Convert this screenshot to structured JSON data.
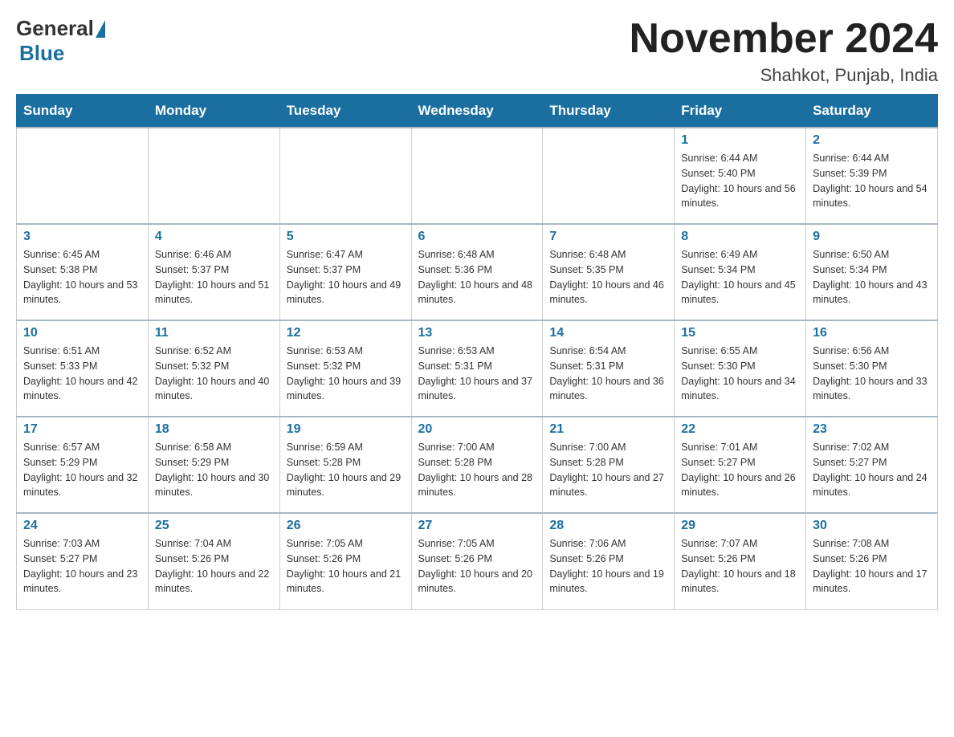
{
  "header": {
    "logo_general": "General",
    "logo_blue": "Blue",
    "month_title": "November 2024",
    "location": "Shahkot, Punjab, India"
  },
  "days_of_week": [
    "Sunday",
    "Monday",
    "Tuesday",
    "Wednesday",
    "Thursday",
    "Friday",
    "Saturday"
  ],
  "weeks": [
    [
      {
        "day": "",
        "sunrise": "",
        "sunset": "",
        "daylight": ""
      },
      {
        "day": "",
        "sunrise": "",
        "sunset": "",
        "daylight": ""
      },
      {
        "day": "",
        "sunrise": "",
        "sunset": "",
        "daylight": ""
      },
      {
        "day": "",
        "sunrise": "",
        "sunset": "",
        "daylight": ""
      },
      {
        "day": "",
        "sunrise": "",
        "sunset": "",
        "daylight": ""
      },
      {
        "day": "1",
        "sunrise": "Sunrise: 6:44 AM",
        "sunset": "Sunset: 5:40 PM",
        "daylight": "Daylight: 10 hours and 56 minutes."
      },
      {
        "day": "2",
        "sunrise": "Sunrise: 6:44 AM",
        "sunset": "Sunset: 5:39 PM",
        "daylight": "Daylight: 10 hours and 54 minutes."
      }
    ],
    [
      {
        "day": "3",
        "sunrise": "Sunrise: 6:45 AM",
        "sunset": "Sunset: 5:38 PM",
        "daylight": "Daylight: 10 hours and 53 minutes."
      },
      {
        "day": "4",
        "sunrise": "Sunrise: 6:46 AM",
        "sunset": "Sunset: 5:37 PM",
        "daylight": "Daylight: 10 hours and 51 minutes."
      },
      {
        "day": "5",
        "sunrise": "Sunrise: 6:47 AM",
        "sunset": "Sunset: 5:37 PM",
        "daylight": "Daylight: 10 hours and 49 minutes."
      },
      {
        "day": "6",
        "sunrise": "Sunrise: 6:48 AM",
        "sunset": "Sunset: 5:36 PM",
        "daylight": "Daylight: 10 hours and 48 minutes."
      },
      {
        "day": "7",
        "sunrise": "Sunrise: 6:48 AM",
        "sunset": "Sunset: 5:35 PM",
        "daylight": "Daylight: 10 hours and 46 minutes."
      },
      {
        "day": "8",
        "sunrise": "Sunrise: 6:49 AM",
        "sunset": "Sunset: 5:34 PM",
        "daylight": "Daylight: 10 hours and 45 minutes."
      },
      {
        "day": "9",
        "sunrise": "Sunrise: 6:50 AM",
        "sunset": "Sunset: 5:34 PM",
        "daylight": "Daylight: 10 hours and 43 minutes."
      }
    ],
    [
      {
        "day": "10",
        "sunrise": "Sunrise: 6:51 AM",
        "sunset": "Sunset: 5:33 PM",
        "daylight": "Daylight: 10 hours and 42 minutes."
      },
      {
        "day": "11",
        "sunrise": "Sunrise: 6:52 AM",
        "sunset": "Sunset: 5:32 PM",
        "daylight": "Daylight: 10 hours and 40 minutes."
      },
      {
        "day": "12",
        "sunrise": "Sunrise: 6:53 AM",
        "sunset": "Sunset: 5:32 PM",
        "daylight": "Daylight: 10 hours and 39 minutes."
      },
      {
        "day": "13",
        "sunrise": "Sunrise: 6:53 AM",
        "sunset": "Sunset: 5:31 PM",
        "daylight": "Daylight: 10 hours and 37 minutes."
      },
      {
        "day": "14",
        "sunrise": "Sunrise: 6:54 AM",
        "sunset": "Sunset: 5:31 PM",
        "daylight": "Daylight: 10 hours and 36 minutes."
      },
      {
        "day": "15",
        "sunrise": "Sunrise: 6:55 AM",
        "sunset": "Sunset: 5:30 PM",
        "daylight": "Daylight: 10 hours and 34 minutes."
      },
      {
        "day": "16",
        "sunrise": "Sunrise: 6:56 AM",
        "sunset": "Sunset: 5:30 PM",
        "daylight": "Daylight: 10 hours and 33 minutes."
      }
    ],
    [
      {
        "day": "17",
        "sunrise": "Sunrise: 6:57 AM",
        "sunset": "Sunset: 5:29 PM",
        "daylight": "Daylight: 10 hours and 32 minutes."
      },
      {
        "day": "18",
        "sunrise": "Sunrise: 6:58 AM",
        "sunset": "Sunset: 5:29 PM",
        "daylight": "Daylight: 10 hours and 30 minutes."
      },
      {
        "day": "19",
        "sunrise": "Sunrise: 6:59 AM",
        "sunset": "Sunset: 5:28 PM",
        "daylight": "Daylight: 10 hours and 29 minutes."
      },
      {
        "day": "20",
        "sunrise": "Sunrise: 7:00 AM",
        "sunset": "Sunset: 5:28 PM",
        "daylight": "Daylight: 10 hours and 28 minutes."
      },
      {
        "day": "21",
        "sunrise": "Sunrise: 7:00 AM",
        "sunset": "Sunset: 5:28 PM",
        "daylight": "Daylight: 10 hours and 27 minutes."
      },
      {
        "day": "22",
        "sunrise": "Sunrise: 7:01 AM",
        "sunset": "Sunset: 5:27 PM",
        "daylight": "Daylight: 10 hours and 26 minutes."
      },
      {
        "day": "23",
        "sunrise": "Sunrise: 7:02 AM",
        "sunset": "Sunset: 5:27 PM",
        "daylight": "Daylight: 10 hours and 24 minutes."
      }
    ],
    [
      {
        "day": "24",
        "sunrise": "Sunrise: 7:03 AM",
        "sunset": "Sunset: 5:27 PM",
        "daylight": "Daylight: 10 hours and 23 minutes."
      },
      {
        "day": "25",
        "sunrise": "Sunrise: 7:04 AM",
        "sunset": "Sunset: 5:26 PM",
        "daylight": "Daylight: 10 hours and 22 minutes."
      },
      {
        "day": "26",
        "sunrise": "Sunrise: 7:05 AM",
        "sunset": "Sunset: 5:26 PM",
        "daylight": "Daylight: 10 hours and 21 minutes."
      },
      {
        "day": "27",
        "sunrise": "Sunrise: 7:05 AM",
        "sunset": "Sunset: 5:26 PM",
        "daylight": "Daylight: 10 hours and 20 minutes."
      },
      {
        "day": "28",
        "sunrise": "Sunrise: 7:06 AM",
        "sunset": "Sunset: 5:26 PM",
        "daylight": "Daylight: 10 hours and 19 minutes."
      },
      {
        "day": "29",
        "sunrise": "Sunrise: 7:07 AM",
        "sunset": "Sunset: 5:26 PM",
        "daylight": "Daylight: 10 hours and 18 minutes."
      },
      {
        "day": "30",
        "sunrise": "Sunrise: 7:08 AM",
        "sunset": "Sunset: 5:26 PM",
        "daylight": "Daylight: 10 hours and 17 minutes."
      }
    ]
  ]
}
